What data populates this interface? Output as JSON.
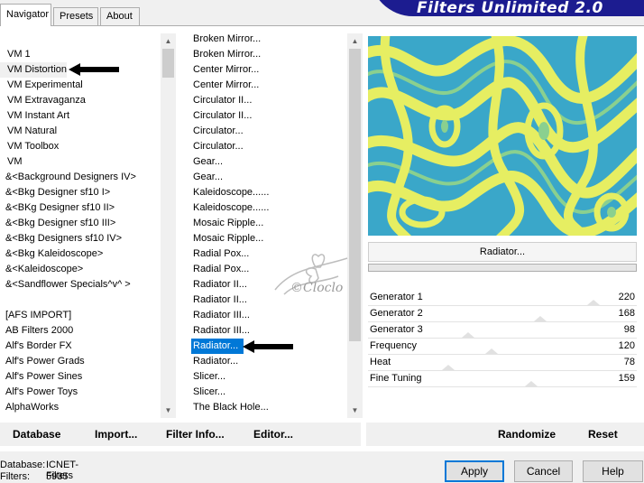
{
  "tabs": [
    {
      "label": "Navigator",
      "active": true
    },
    {
      "label": "Presets",
      "active": false
    },
    {
      "label": "About",
      "active": false
    }
  ],
  "banner": {
    "title": "Filters Unlimited 2.0"
  },
  "categories": [
    "VM 1",
    "VM Distortion",
    "VM Experimental",
    "VM Extravaganza",
    "VM Instant Art",
    "VM Natural",
    "VM Toolbox",
    "VM",
    "&<Background Designers IV>",
    "&<Bkg Designer sf10 I>",
    "&<BKg Designer sf10 II>",
    "&<Bkg Designer sf10 III>",
    "&<Bkg Designers sf10 IV>",
    "&<Bkg Kaleidoscope>",
    "&<Kaleidoscope>",
    "&<Sandflower Specials^v^ >",
    "",
    "[AFS IMPORT]",
    "AB Filters 2000",
    "Alf's Border FX",
    "Alf's Power Grads",
    "Alf's Power Sines",
    "Alf's Power Toys",
    "AlphaWorks"
  ],
  "selected_category": "VM Distortion",
  "filters": [
    "Broken Mirror...",
    "Broken Mirror...",
    "Center Mirror...",
    "Center Mirror...",
    "Circulator II...",
    "Circulator II...",
    "Circulator...",
    "Circulator...",
    "Gear...",
    "Gear...",
    "Kaleidoscope......",
    "Kaleidoscope......",
    "Mosaic Ripple...",
    "Mosaic Ripple...",
    "Radial Pox...",
    "Radial Pox...",
    "Radiator II...",
    "Radiator II...",
    "Radiator III...",
    "Radiator III...",
    "Radiator...",
    "Radiator...",
    "Slicer...",
    "Slicer...",
    "The Black Hole..."
  ],
  "selected_filter": "Radiator...",
  "current_filter": "Radiator...",
  "watermark": "©Cloclo",
  "sliders": [
    {
      "label": "Generator 1",
      "value": "220",
      "fraction": 0.863
    },
    {
      "label": "Generator 2",
      "value": "168",
      "fraction": 0.659
    },
    {
      "label": "Generator 3",
      "value": "98",
      "fraction": 0.384
    },
    {
      "label": "Frequency",
      "value": "120",
      "fraction": 0.471
    },
    {
      "label": "Heat",
      "value": "78",
      "fraction": 0.306
    },
    {
      "label": "Fine Tuning",
      "value": "159",
      "fraction": 0.624
    }
  ],
  "toolbar": {
    "database": "Database",
    "import": "Import...",
    "filter_info": "Filter Info...",
    "editor": "Editor...",
    "randomize": "Randomize",
    "reset": "Reset"
  },
  "status": {
    "database_label": "Database:",
    "database_value": "ICNET-Filters",
    "filters_label": "Filters:",
    "filters_value": "5935"
  },
  "buttons": {
    "apply": "Apply",
    "cancel": "Cancel",
    "help": "Help"
  },
  "colors": {
    "selection": "#0078d7",
    "banner": "#1c1c90",
    "preview_yellow": "#e6ee62",
    "preview_cyan": "#3aa7c9",
    "preview_green": "#8ad08f"
  }
}
